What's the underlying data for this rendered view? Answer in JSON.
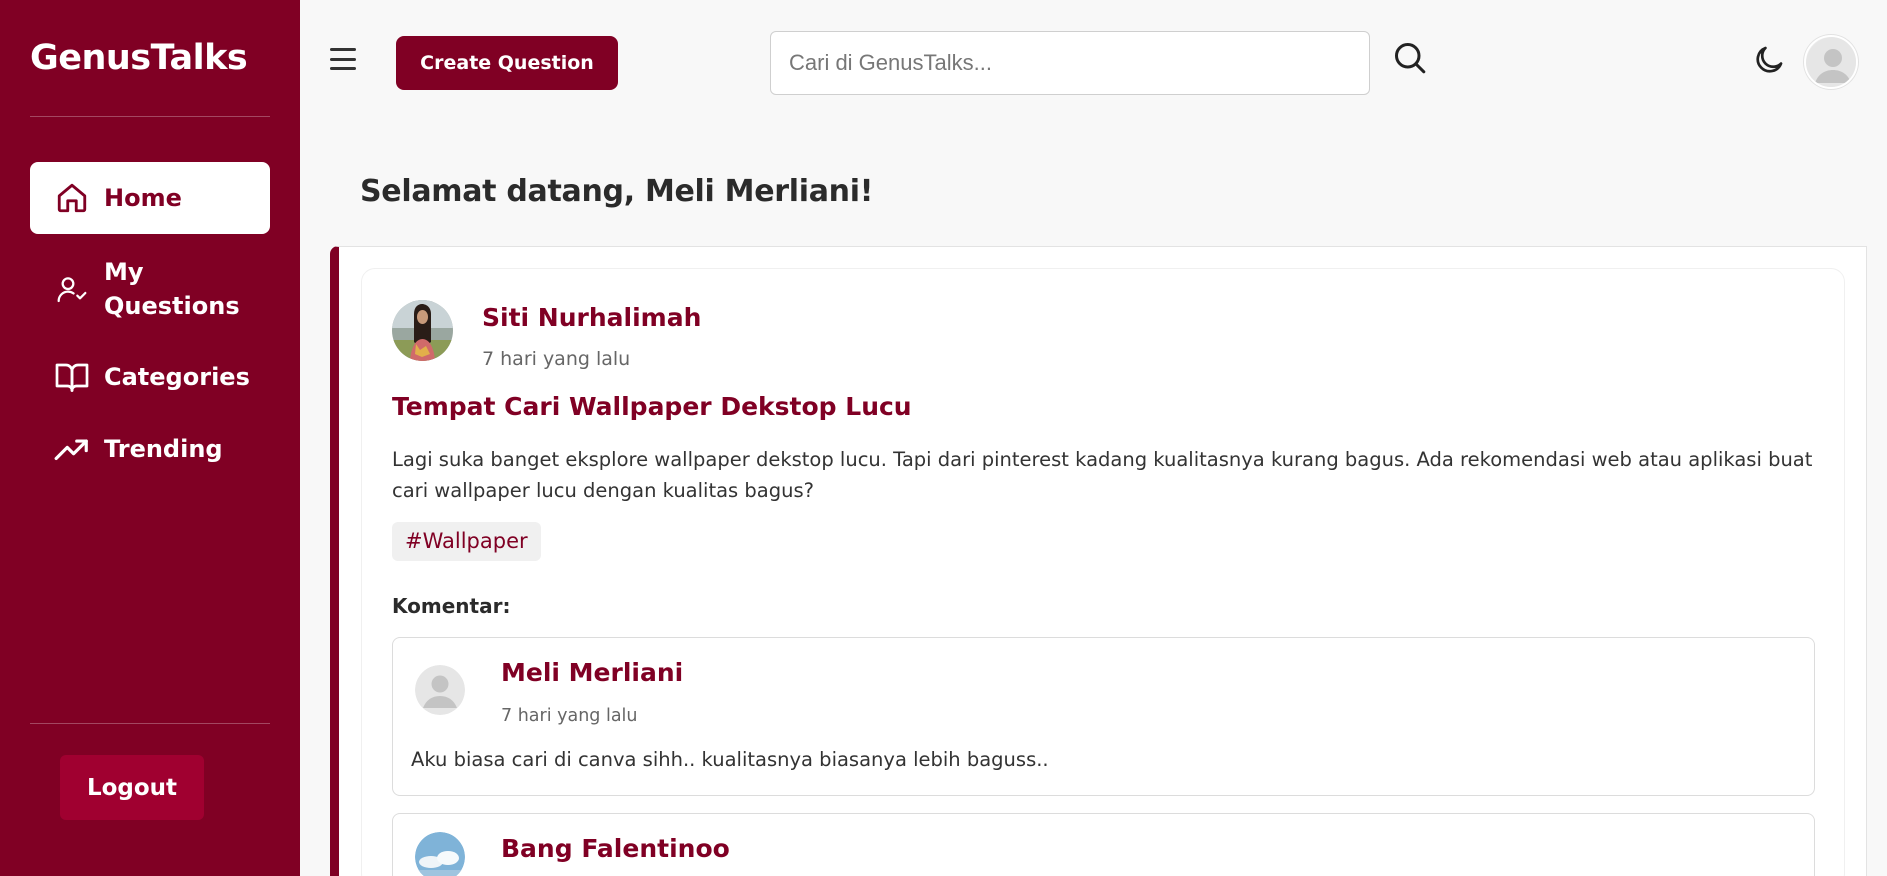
{
  "sidebar": {
    "brand": "GenusTalks",
    "items": [
      {
        "label": "Home",
        "icon": "home-icon",
        "active": true
      },
      {
        "label": "My Questions",
        "icon": "user-check-icon",
        "active": false
      },
      {
        "label": "Categories",
        "icon": "book-open-icon",
        "active": false
      },
      {
        "label": "Trending",
        "icon": "trending-up-icon",
        "active": false
      }
    ],
    "logout_label": "Logout"
  },
  "topbar": {
    "create_label": "Create Question",
    "search_placeholder": "Cari di GenusTalks...",
    "icons": [
      "menu-icon",
      "search-icon",
      "moon-icon",
      "avatar"
    ]
  },
  "main": {
    "welcome": "Selamat datang, Meli Merliani!",
    "post": {
      "author": "Siti Nurhalimah",
      "time": "7 hari yang lalu",
      "title": "Tempat Cari Wallpaper Dekstop Lucu",
      "body": "Lagi suka banget eksplore wallpaper dekstop lucu. Tapi dari pinterest kadang kualitasnya kurang bagus. Ada rekomendasi web atau aplikasi buat cari wallpaper lucu dengan kualitas bagus?",
      "tag": "#Wallpaper",
      "comments_label": "Komentar:",
      "comments": [
        {
          "author": "Meli Merliani",
          "time": "7 hari yang lalu",
          "text": "Aku biasa cari di canva sihh.. kualitasnya biasanya lebih baguss.."
        },
        {
          "author": "Bang Falentinoo",
          "time": "",
          "text": ""
        }
      ]
    }
  },
  "colors": {
    "brand": "#800024",
    "logout": "#a00030",
    "background": "#f8f8f8"
  }
}
